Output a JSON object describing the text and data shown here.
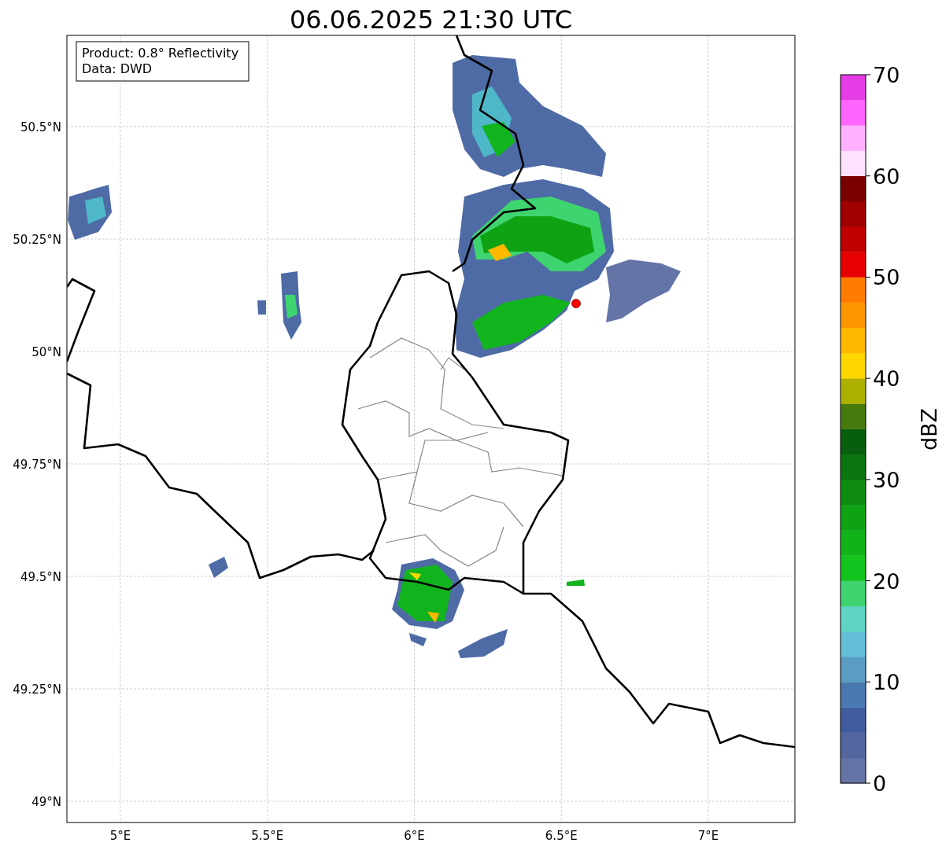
{
  "title": "06.06.2025 21:30 UTC",
  "legend": [
    "Product: 0.8° Reflectivity",
    "Data: DWD"
  ],
  "map": {
    "lon_ticks": [
      "5°E",
      "5.5°E",
      "6°E",
      "6.5°E",
      "7°E"
    ],
    "lat_ticks": [
      "50.5°N",
      "50.25°N",
      "50°N",
      "49.75°N",
      "49.5°N",
      "49.25°N",
      "49°N"
    ]
  },
  "colorbar": {
    "label": "dBZ",
    "ticks": [
      "70",
      "60",
      "50",
      "40",
      "30",
      "20",
      "10",
      "0"
    ],
    "bins": [
      {
        "color": "#6474a6"
      },
      {
        "color": "#5366a0"
      },
      {
        "color": "#405c9f"
      },
      {
        "color": "#4a78b0"
      },
      {
        "color": "#5a9cc4"
      },
      {
        "color": "#63bfd8"
      },
      {
        "color": "#5fd5c4"
      },
      {
        "color": "#3ed46f"
      },
      {
        "color": "#12c41e"
      },
      {
        "color": "#10b318"
      },
      {
        "color": "#0fa314"
      },
      {
        "color": "#0d8c10"
      },
      {
        "color": "#0b7510"
      },
      {
        "color": "#075e0c"
      },
      {
        "color": "#467a0d"
      },
      {
        "color": "#adb000"
      },
      {
        "color": "#ffd700"
      },
      {
        "color": "#ffb800"
      },
      {
        "color": "#ff9800"
      },
      {
        "color": "#ff7c00"
      },
      {
        "color": "#e60000"
      },
      {
        "color": "#c00000"
      },
      {
        "color": "#a00000"
      },
      {
        "color": "#7a0000"
      },
      {
        "color": "#ffe0ff"
      },
      {
        "color": "#ffb0ff"
      },
      {
        "color": "#ff66ff"
      },
      {
        "color": "#e63ce6"
      }
    ]
  }
}
